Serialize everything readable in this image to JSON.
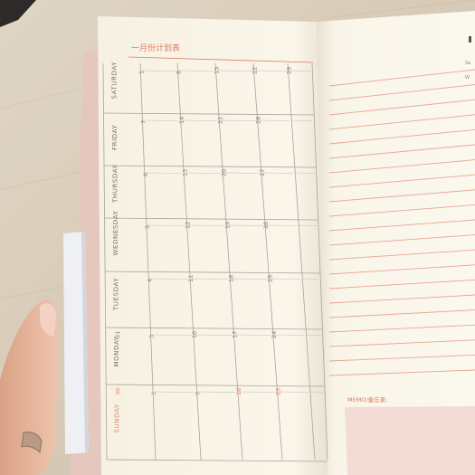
{
  "planner": {
    "title": "一月份计划表",
    "memo_label": "MEMO/备忘录:",
    "edge_text": [
      "Sa",
      "W"
    ],
    "weekdays": [
      "SATURDAY",
      "FRIDAY",
      "THURSDAY",
      "WEDNESDAY",
      "TUESDAY",
      "MONDAY",
      "SUNDAY"
    ],
    "columns": [
      {
        "label": "SATURDAY",
        "dates": [
          "",
          "1",
          "8",
          "15",
          "22",
          "29"
        ]
      },
      {
        "label": "FRIDAY",
        "dates": [
          "",
          "7",
          "14",
          "21",
          "28"
        ]
      },
      {
        "label": "THURSDAY",
        "dates": [
          "",
          "6",
          "13",
          "20",
          "27"
        ]
      },
      {
        "label": "WEDNESDAY",
        "dates": [
          "",
          "5",
          "12",
          "19",
          "26"
        ]
      },
      {
        "label": "TUESDAY",
        "dates": [
          "",
          "4",
          "11",
          "18",
          "25"
        ]
      },
      {
        "label": "MONDAY",
        "dates": [
          "31",
          "3",
          "10",
          "17",
          "24"
        ]
      },
      {
        "label": "SUNDAY",
        "dates": [
          "30",
          "2",
          "9",
          "16",
          "23"
        ]
      }
    ]
  },
  "colors": {
    "desk": "#d9ccb9",
    "page": "#faf6e9",
    "accent": "#e07b63",
    "grid": "#a9a29b",
    "memo_box": "#f4dcd6",
    "cover": "#e7c9c0",
    "clip": "#eceef3",
    "skin": "#e8b9a1"
  }
}
